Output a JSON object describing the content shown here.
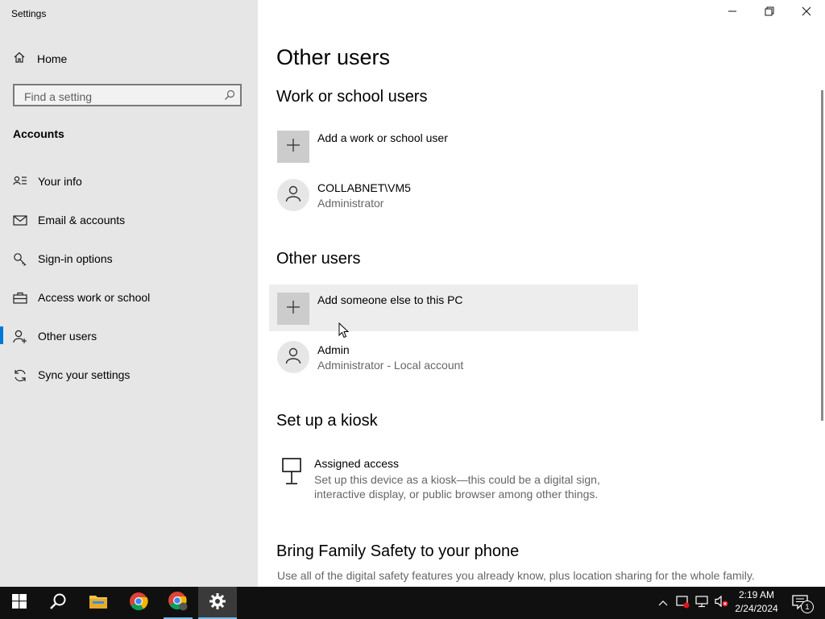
{
  "window": {
    "title": "Settings"
  },
  "sidebar": {
    "home_label": "Home",
    "search_placeholder": "Find a setting",
    "section_label": "Accounts",
    "items": [
      {
        "label": "Your info",
        "icon": "contact-card-icon"
      },
      {
        "label": "Email & accounts",
        "icon": "mail-icon"
      },
      {
        "label": "Sign-in options",
        "icon": "key-icon"
      },
      {
        "label": "Access work or school",
        "icon": "briefcase-icon"
      },
      {
        "label": "Other users",
        "icon": "add-person-icon",
        "active": true
      },
      {
        "label": "Sync your settings",
        "icon": "sync-icon"
      }
    ]
  },
  "main": {
    "title": "Other users",
    "work_section": {
      "heading": "Work or school users",
      "add_label": "Add a work or school user",
      "user": {
        "name": "COLLABNET\\VM5",
        "role": "Administrator"
      }
    },
    "other_section": {
      "heading": "Other users",
      "add_label": "Add someone else to this PC",
      "user": {
        "name": "Admin",
        "role": "Administrator - Local account"
      }
    },
    "kiosk_section": {
      "heading": "Set up a kiosk",
      "title": "Assigned access",
      "description": "Set up this device as a kiosk—this could be a digital sign, interactive display, or public browser among other things."
    },
    "family_section": {
      "heading": "Bring Family Safety to your phone",
      "description": "Use all of the digital safety features you already know, plus location sharing for the whole family."
    }
  },
  "taskbar": {
    "apps": [
      "start",
      "search",
      "file-explorer",
      "chrome",
      "chrome-profile",
      "settings"
    ],
    "clock": {
      "time": "2:19 AM",
      "date": "2/24/2024"
    },
    "notification_count": "1"
  },
  "colors": {
    "accent": "#0078d7",
    "sidebar_bg": "#e6e6e6",
    "taskbar_bg": "#101010"
  }
}
